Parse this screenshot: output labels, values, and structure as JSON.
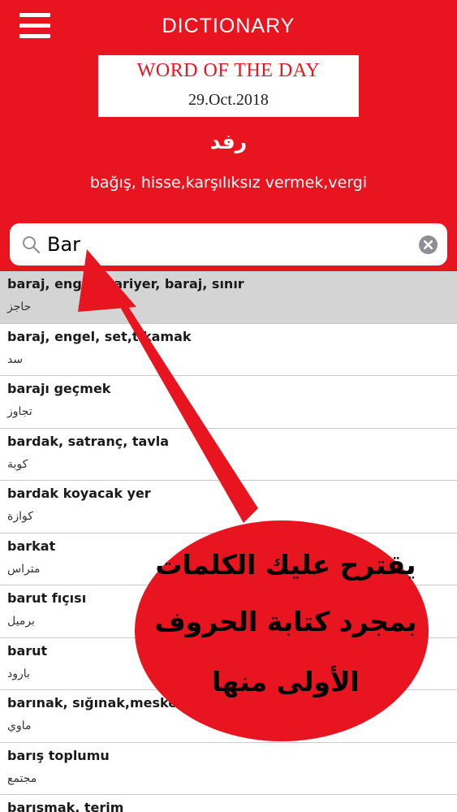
{
  "header": {
    "title": "DICTIONARY",
    "bg_color": "#e8141f"
  },
  "word_of_the_day": {
    "heading": "WORD OF THE DAY",
    "date": "29.Oct.2018",
    "word": "رفد",
    "meaning": "bağış, hisse,karşılıksız vermek,vergi"
  },
  "search": {
    "value": "Bar",
    "icon": "search-icon",
    "clear_icon": "clear-icon"
  },
  "results": [
    {
      "term": "baraj, engel, bariyer, baraj, sınır",
      "translation": "حاجز",
      "selected": true
    },
    {
      "term": "baraj, engel, set,tıkamak",
      "translation": "سد"
    },
    {
      "term": "barajı geçmek",
      "translation": "تجاوز"
    },
    {
      "term": "bardak, satranç, tavla",
      "translation": "كوبة"
    },
    {
      "term": "bardak koyacak yer",
      "translation": "كوازة"
    },
    {
      "term": "barkat",
      "translation": "متراس"
    },
    {
      "term": "barut fıçısı",
      "translation": "برميل"
    },
    {
      "term": "barut",
      "translation": "بارود"
    },
    {
      "term": "barınak, sığınak,mesken,",
      "translation": "ماوي"
    },
    {
      "term": "barış toplumu",
      "translation": "مجتمع"
    },
    {
      "term": "barışmak, terim",
      "translation": ""
    }
  ],
  "annotation": {
    "line1": "يقترح عليك الكلمات",
    "line2": "بمجرد كتابة الحروف",
    "line3": "الأولى منها",
    "color": "#e8141f"
  }
}
